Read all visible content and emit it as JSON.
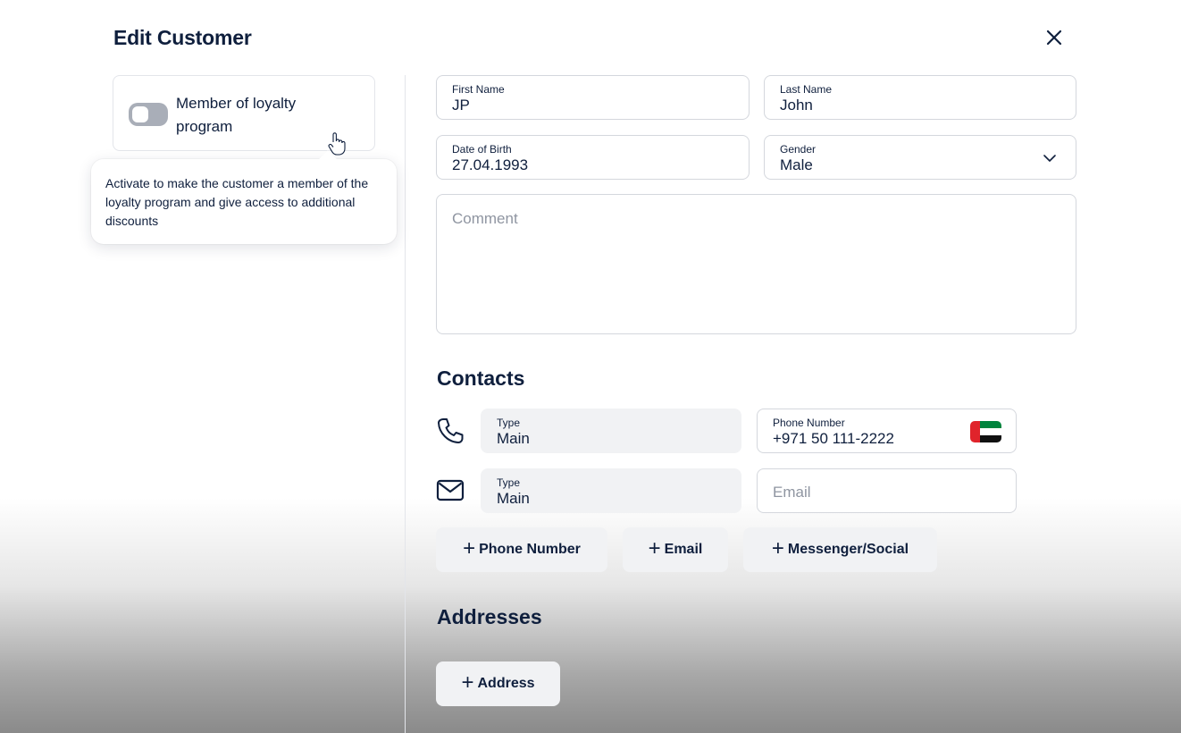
{
  "modal": {
    "title": "Edit Customer"
  },
  "loyalty": {
    "label": "Member of loyalty program",
    "enabled": false,
    "tooltip": "Activate to make the customer a member of the loyalty program and give access to additional discounts"
  },
  "form": {
    "first_name": {
      "label": "First Name",
      "value": "JP"
    },
    "last_name": {
      "label": "Last Name",
      "value": "John"
    },
    "dob": {
      "label": "Date of Birth",
      "value": "27.04.1993"
    },
    "gender": {
      "label": "Gender",
      "value": "Male"
    },
    "comment": {
      "placeholder": "Comment"
    }
  },
  "contacts": {
    "title": "Contacts",
    "phone": {
      "type_label": "Type",
      "type_value": "Main",
      "number_label": "Phone Number",
      "number_value": "+971 50 111-2222",
      "flag": "uae-flag-icon"
    },
    "email": {
      "type_label": "Type",
      "type_value": "Main",
      "placeholder": "Email"
    },
    "buttons": {
      "add_phone": "Phone Number",
      "add_email": "Email",
      "add_messenger": "Messenger/Social"
    }
  },
  "addresses": {
    "title": "Addresses",
    "add_button": "Address"
  },
  "colors": {
    "text": "#0f1f3d",
    "border": "#d4d7dd",
    "filled_bg": "#f1f2f4",
    "toggle_off": "#a9aeb8",
    "placeholder": "#8f95a1"
  }
}
